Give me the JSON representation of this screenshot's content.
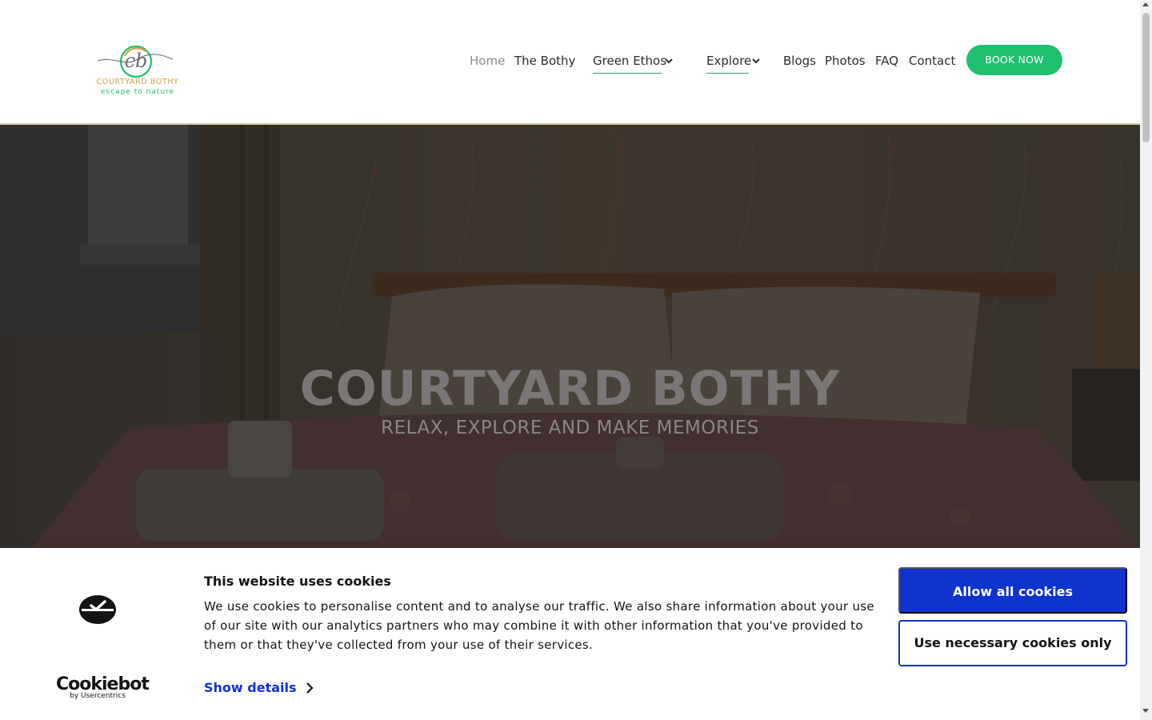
{
  "header": {
    "logo": {
      "monogram": "cb",
      "name": "COURTYARD BOTHY",
      "tagline": "escape to nature",
      "name_color": "#d4a24a",
      "tagline_color": "#1ebf6d"
    },
    "nav": {
      "items": [
        {
          "label": "Home",
          "active": true
        },
        {
          "label": "The Bothy"
        },
        {
          "label": "Green Ethos",
          "dropdown": true
        },
        {
          "label": "Explore",
          "dropdown": true
        },
        {
          "label": "Blogs"
        },
        {
          "label": "Photos"
        },
        {
          "label": "FAQ"
        },
        {
          "label": "Contact"
        }
      ],
      "cta": "BOOK NOW",
      "cta_color": "#1ebf6d"
    }
  },
  "hero": {
    "title": "COURTYARD BOTHY",
    "subtitle": "RELAX, EXPLORE AND MAKE MEMORIES"
  },
  "cookie_banner": {
    "brand_name": "Cookiebot",
    "brand_by": "by Usercentrics",
    "title": "This website uses cookies",
    "text": "We use cookies to personalise content and to analyse our traffic. We also share information about your use of our site with our analytics partners who may combine it with other information that you've provided to them or that they've collected from your use of their services.",
    "show_details": "Show details",
    "allow_all": "Allow all cookies",
    "necessary_only": "Use necessary cookies only",
    "accent_color": "#1032cf"
  },
  "icons": {
    "dropdown": "chevron-down-icon",
    "show_details": "chevron-right-icon",
    "cookiebot": "cookiebot-logo-icon"
  }
}
